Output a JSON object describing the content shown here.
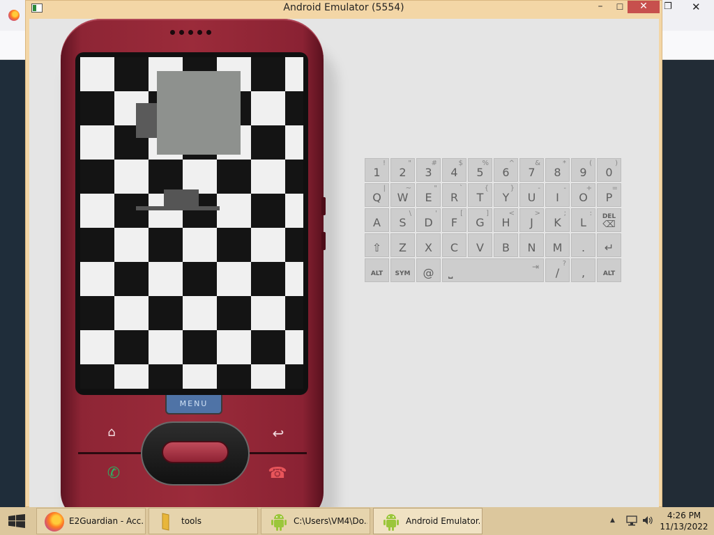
{
  "emulator": {
    "title": "Android Emulator (5554)",
    "menu_key_label": "MENU"
  },
  "keyboard": {
    "rows": [
      [
        {
          "main": "1",
          "sub": "!"
        },
        {
          "main": "2",
          "sub": "\""
        },
        {
          "main": "3",
          "sub": "#"
        },
        {
          "main": "4",
          "sub": "$"
        },
        {
          "main": "5",
          "sub": "%"
        },
        {
          "main": "6",
          "sub": "^"
        },
        {
          "main": "7",
          "sub": "&"
        },
        {
          "main": "8",
          "sub": "*"
        },
        {
          "main": "9",
          "sub": "("
        },
        {
          "main": "0",
          "sub": ")"
        }
      ],
      [
        {
          "main": "Q",
          "sub": "|"
        },
        {
          "main": "W",
          "sub": "~"
        },
        {
          "main": "E",
          "sub": "\""
        },
        {
          "main": "R",
          "sub": "`"
        },
        {
          "main": "T",
          "sub": "{"
        },
        {
          "main": "Y",
          "sub": "}"
        },
        {
          "main": "U",
          "sub": "-"
        },
        {
          "main": "I",
          "sub": "-"
        },
        {
          "main": "O",
          "sub": "+"
        },
        {
          "main": "P",
          "sub": "="
        }
      ],
      [
        {
          "main": "A",
          "sub": ""
        },
        {
          "main": "S",
          "sub": "\\"
        },
        {
          "main": "D",
          "sub": "'"
        },
        {
          "main": "F",
          "sub": "["
        },
        {
          "main": "G",
          "sub": "]"
        },
        {
          "main": "H",
          "sub": "<"
        },
        {
          "main": "J",
          "sub": ">"
        },
        {
          "main": "K",
          "sub": ";"
        },
        {
          "main": "L",
          "sub": ":"
        },
        {
          "main": "DEL",
          "sub": ""
        }
      ],
      [
        {
          "main": "⇧",
          "sub": ""
        },
        {
          "main": "Z",
          "sub": ""
        },
        {
          "main": "X",
          "sub": ""
        },
        {
          "main": "C",
          "sub": ""
        },
        {
          "main": "V",
          "sub": ""
        },
        {
          "main": "B",
          "sub": ""
        },
        {
          "main": "N",
          "sub": ""
        },
        {
          "main": "M",
          "sub": ""
        },
        {
          "main": ".",
          "sub": ""
        },
        {
          "main": "↵",
          "sub": ""
        }
      ]
    ],
    "bottom": {
      "alt_left": "ALT",
      "sym": "SYM",
      "at": "@",
      "space": "⎵",
      "tab": "⇥",
      "slash": "/",
      "slash_sub": "?",
      "comma": ",",
      "alt_right": "ALT"
    }
  },
  "taskbar": {
    "items": [
      {
        "label": "E2Guardian - Acc..."
      },
      {
        "label": "tools"
      },
      {
        "label": "C:\\Users\\VM4\\Do..."
      },
      {
        "label": "Android Emulator..."
      }
    ],
    "clock_time": "4:26 PM",
    "clock_date": "11/13/2022"
  },
  "colors": {
    "phone_body": "#9b2b3a",
    "emulator_titlebar": "#f3d6a6",
    "taskbar": "#dcc79d",
    "menu_key": "#4f73a6"
  }
}
